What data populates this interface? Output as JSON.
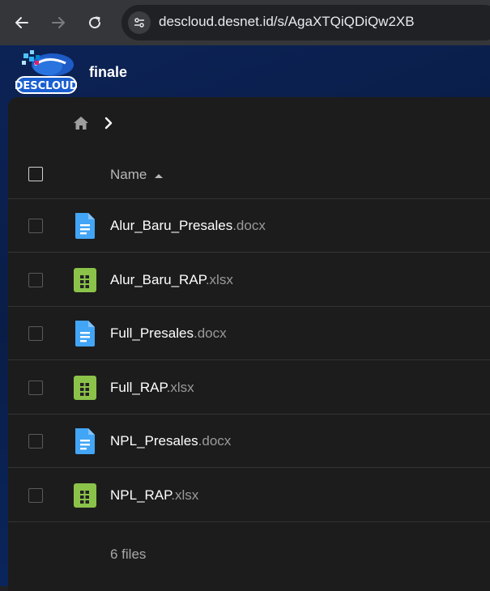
{
  "browser": {
    "url": "descloud.desnet.id/s/AgaXTQiQDiQw2XB"
  },
  "header": {
    "logo_text": "DESCLOUD",
    "folder_title": "finale"
  },
  "table": {
    "column_name": "Name",
    "files": [
      {
        "base": "Alur_Baru_Presales",
        "ext": ".docx",
        "type": "document"
      },
      {
        "base": "Alur_Baru_RAP",
        "ext": ".xlsx",
        "type": "spreadsheet"
      },
      {
        "base": "Full_Presales",
        "ext": ".docx",
        "type": "document"
      },
      {
        "base": "Full_RAP",
        "ext": ".xlsx",
        "type": "spreadsheet"
      },
      {
        "base": "NPL_Presales",
        "ext": ".docx",
        "type": "document"
      },
      {
        "base": "NPL_RAP",
        "ext": ".xlsx",
        "type": "spreadsheet"
      }
    ],
    "summary": "6 files"
  },
  "colors": {
    "doc_icon": "#42a5f5",
    "sheet_icon": "#8bc34a",
    "panel_bg": "#1c1c1c",
    "header_bg": "#0c2356"
  },
  "icons": {
    "back": "arrow-back-icon",
    "forward": "arrow-forward-icon",
    "reload": "reload-icon",
    "site_info": "tune-icon",
    "home": "home-icon",
    "breadcrumb_sep": "chevron-right-icon"
  }
}
